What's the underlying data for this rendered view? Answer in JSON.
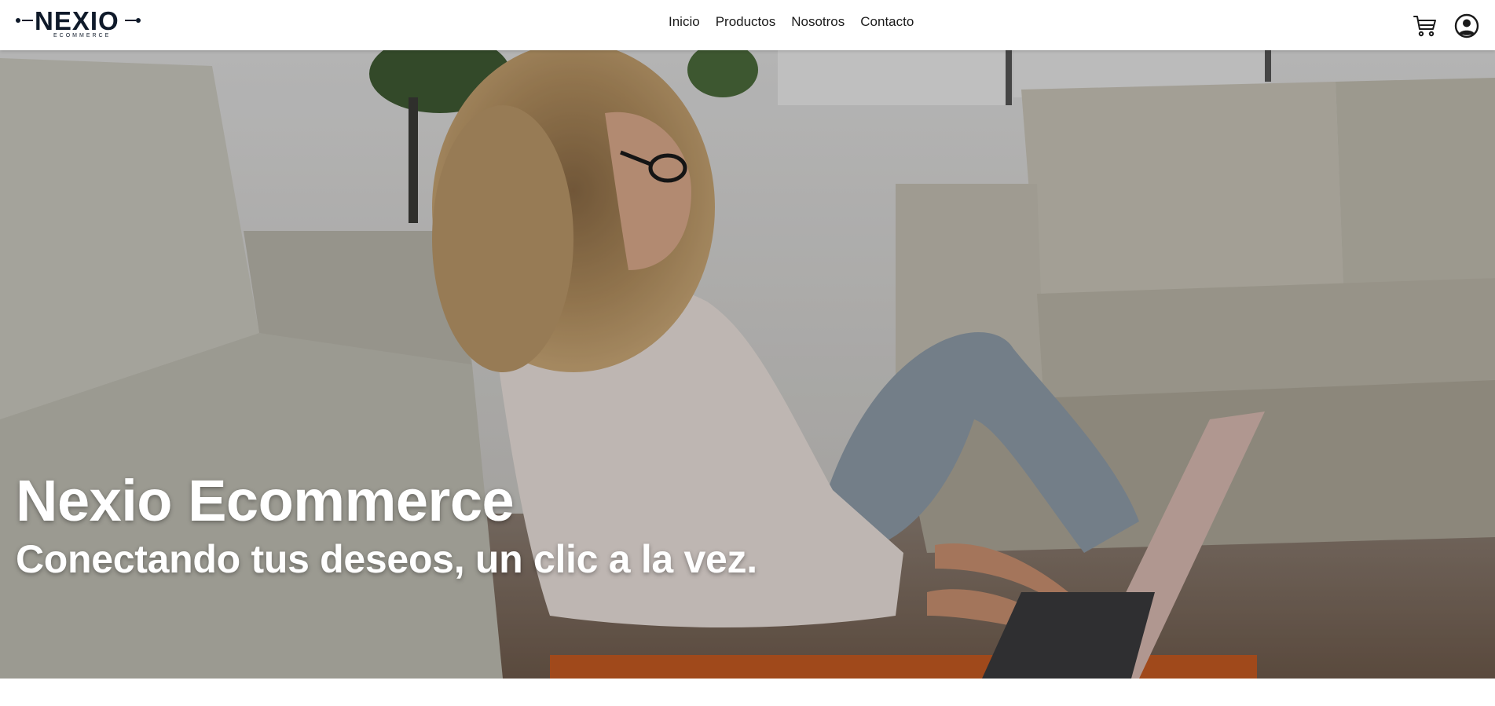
{
  "brand": {
    "name": "NEXIO",
    "tagline": "ECOMMERCE"
  },
  "nav": {
    "links": [
      {
        "label": "Inicio"
      },
      {
        "label": "Productos"
      },
      {
        "label": "Nosotros"
      },
      {
        "label": "Contacto"
      }
    ]
  },
  "header_icons": {
    "cart": "cart-icon",
    "account": "user-circle-icon"
  },
  "hero": {
    "title": "Nexio Ecommerce",
    "subtitle": "Conectando tus deseos, un clic a la vez."
  },
  "colors": {
    "brand_dark": "#0f1a2a",
    "nav_text": "#1a1a1a",
    "hero_text": "#ffffff"
  }
}
